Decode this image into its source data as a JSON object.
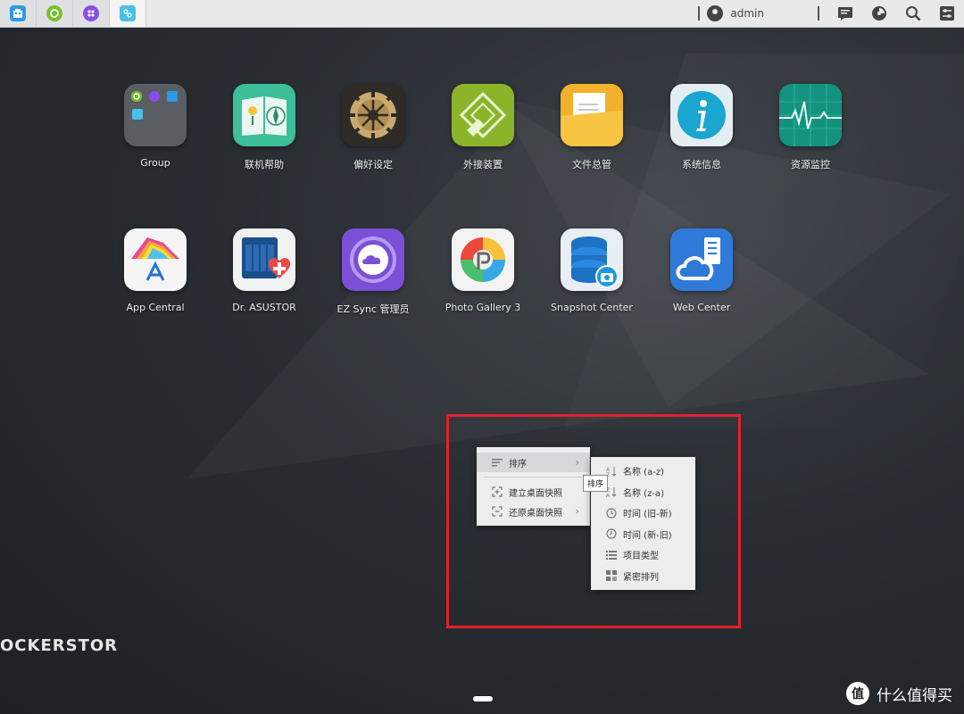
{
  "taskbar": {
    "apps": [
      {
        "name": "group-app",
        "color": "#2b9be8"
      },
      {
        "name": "ez-sync-app",
        "color": "#78c22b"
      },
      {
        "name": "photo-app",
        "color": "#8a4ee8"
      },
      {
        "name": "share-app",
        "color": "#4ac0e8"
      }
    ],
    "user": "admin"
  },
  "apps": [
    {
      "label": "Group"
    },
    {
      "label": "联机帮助"
    },
    {
      "label": "偏好设定"
    },
    {
      "label": "外接装置"
    },
    {
      "label": "文件总管"
    },
    {
      "label": "系统信息"
    },
    {
      "label": "资源监控"
    },
    {
      "label": "App Central"
    },
    {
      "label": "Dr. ASUSTOR"
    },
    {
      "label": "EZ Sync 管理员"
    },
    {
      "label": "Photo Gallery 3"
    },
    {
      "label": "Snapshot Center"
    },
    {
      "label": "Web Center"
    }
  ],
  "brand": "OCKERSTOR",
  "context_menu": {
    "items": [
      {
        "label": "排序",
        "icon": "sort-icon"
      },
      {
        "label": "建立桌面快照",
        "icon": "snapshot-create-icon"
      },
      {
        "label": "还原桌面快照",
        "icon": "snapshot-restore-icon"
      }
    ],
    "tooltip": "排序",
    "submenu": [
      {
        "label": "名称 (a-z)",
        "icon": "sort-az-icon"
      },
      {
        "label": "名称 (z-a)",
        "icon": "sort-za-icon"
      },
      {
        "label": "时间 (旧-新)",
        "icon": "clock-old-icon"
      },
      {
        "label": "时间 (新-旧)",
        "icon": "clock-new-icon"
      },
      {
        "label": "项目类型",
        "icon": "list-icon"
      },
      {
        "label": "紧密排列",
        "icon": "grid-icon"
      }
    ]
  },
  "watermark": {
    "logo": "值",
    "text": "什么值得买"
  }
}
